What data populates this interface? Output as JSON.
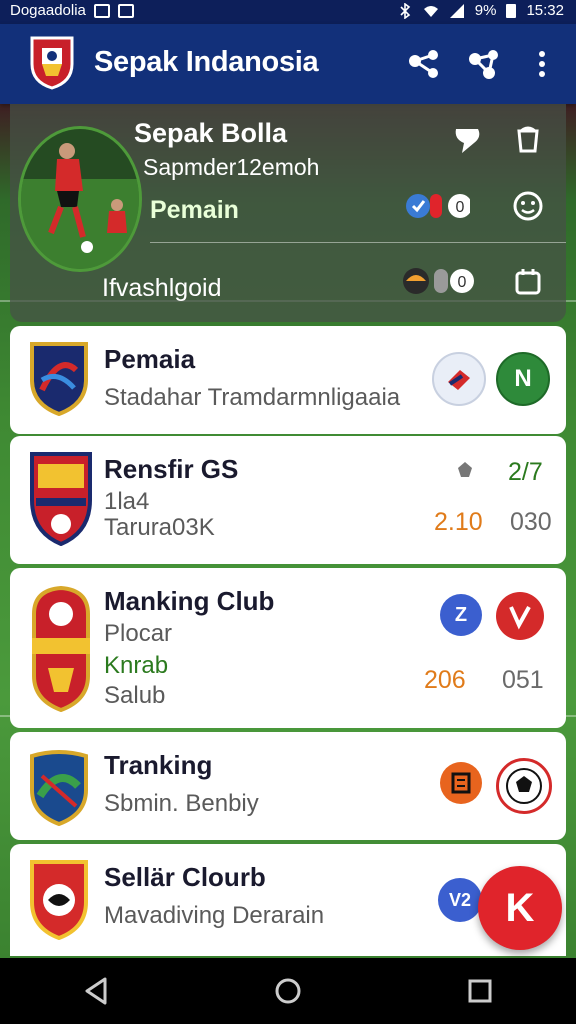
{
  "status_bar": {
    "carrier": "Dogaadolia",
    "battery": "9%",
    "time": "15:32"
  },
  "app_bar": {
    "title": "Sepak Indanosia"
  },
  "hero": {
    "title": "Sepak Bolla",
    "subtitle": "Sapmder12emoh",
    "role": "Pemain",
    "footer": "Ifvashlgoid"
  },
  "items": [
    {
      "title": "Pemaia",
      "line1": "Stadahar Tramdarmnligaaia",
      "badge_right_label": "N"
    },
    {
      "title": "Rensfir GS",
      "line1": "1la4",
      "line2": "Tarura",
      "line2_suffix": "03K",
      "stat_top": "2/7",
      "stat_left": "2.10",
      "stat_right": "030"
    },
    {
      "title": "Manking Club",
      "line1": "Plocar",
      "line2": "Knrab",
      "line3": "Salub",
      "badge_left_label": "Z",
      "stat_left": "206",
      "stat_right": "051"
    },
    {
      "title": "Tranking",
      "line1": "Sbmin. Benbiy"
    },
    {
      "title": "Sellär Clourb",
      "line1": "Mavadiving Derarain",
      "badge_left_label": "V2"
    }
  ],
  "fab": {
    "label": "K"
  },
  "colors": {
    "app_bar": "#12307a",
    "status_bar": "#0d1f5a",
    "accent_red": "#e0242b",
    "stat_orange": "#e07b1a",
    "stat_green": "#2b7a1e"
  }
}
